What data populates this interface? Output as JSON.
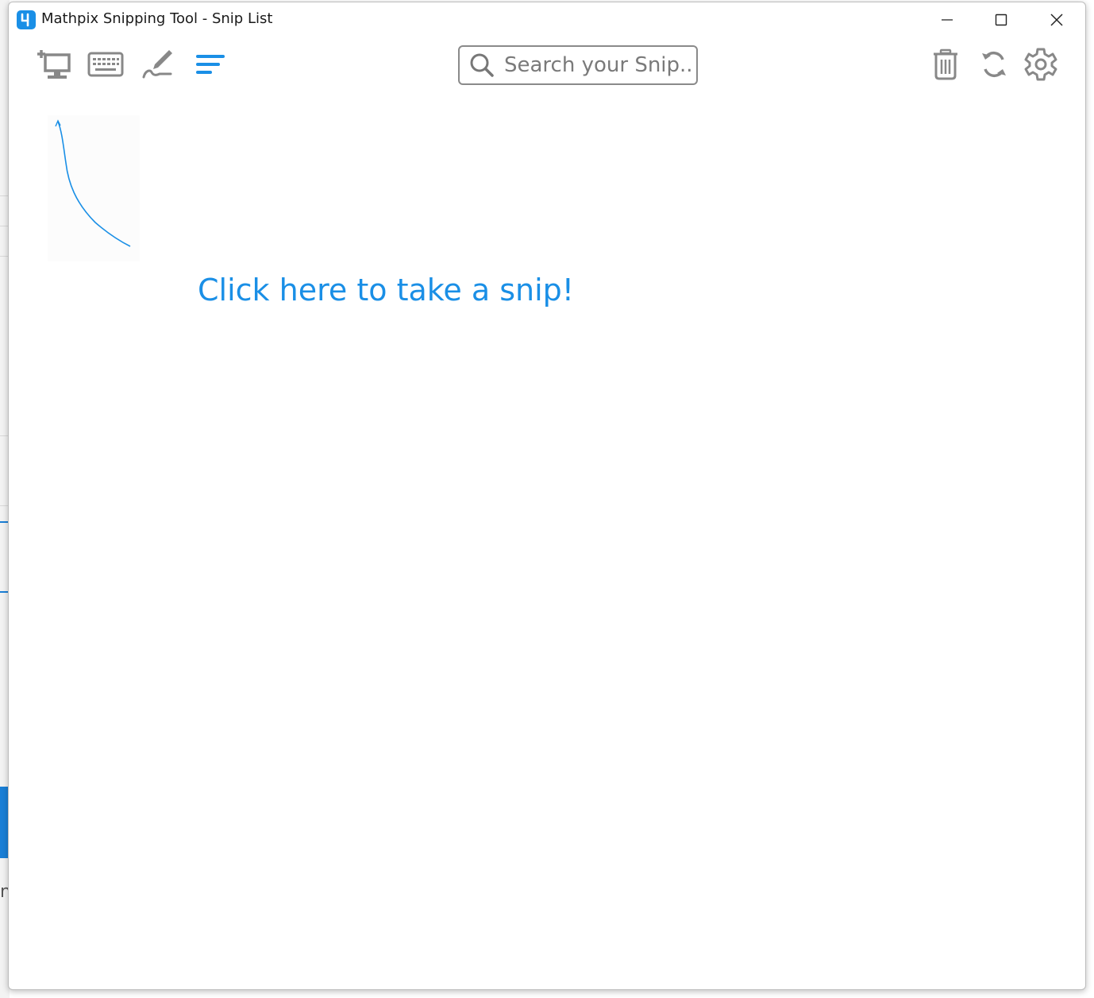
{
  "window": {
    "title": "Mathpix Snipping Tool - Snip List",
    "app_icon": "mathpix-logo-icon",
    "controls": [
      "minimize-icon",
      "maximize-icon",
      "close-icon"
    ]
  },
  "toolbar": {
    "left_icons": [
      "screen-snip-icon",
      "keyboard-icon",
      "handwriting-pen-icon",
      "list-menu-icon"
    ],
    "right_icons": [
      "trash-icon",
      "sync-icon",
      "gear-icon"
    ]
  },
  "search": {
    "placeholder": "Search your Snip...",
    "value": ""
  },
  "main": {
    "take_snip_link": "Click here to take a snip!"
  },
  "colors": {
    "accent": "#1a8fe6",
    "icon_gray": "#888888",
    "border_gray": "#8a8a8a"
  }
}
